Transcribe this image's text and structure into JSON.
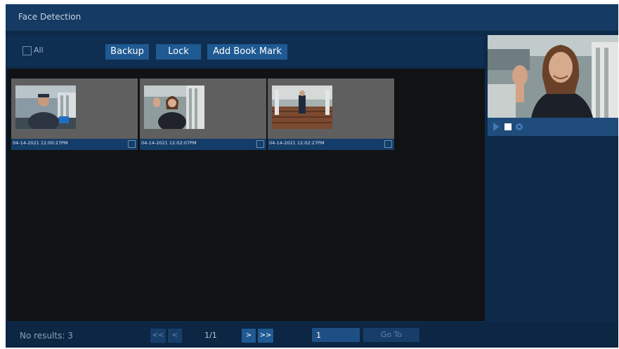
{
  "title": "Face Detection",
  "toolbar": {
    "all_label": "All",
    "backup_label": "Backup",
    "lock_label": "Lock",
    "bookmark_label": "Add Book Mark"
  },
  "results": [
    {
      "timestamp": "04-14-2021 12:00:27PM",
      "selected": false
    },
    {
      "timestamp": "04-14-2021 12:02:07PM",
      "selected": false
    },
    {
      "timestamp": "04-14-2021 12:02:27PM",
      "selected": false
    }
  ],
  "preview": {
    "controls": [
      "play-icon",
      "stop-icon",
      "settings-icon"
    ]
  },
  "pagination": {
    "no_results_label": "No results: 3",
    "first_label": "<<",
    "prev_label": "<",
    "page_indicator": "1/1",
    "next_label": ">",
    "last_label": ">>",
    "page_input_value": "1",
    "goto_label": "Go To"
  },
  "colors": {
    "panel": "#0d2a4a",
    "titlebar": "#153a63",
    "accent": "#1f5a92",
    "results_bg": "#111214"
  }
}
